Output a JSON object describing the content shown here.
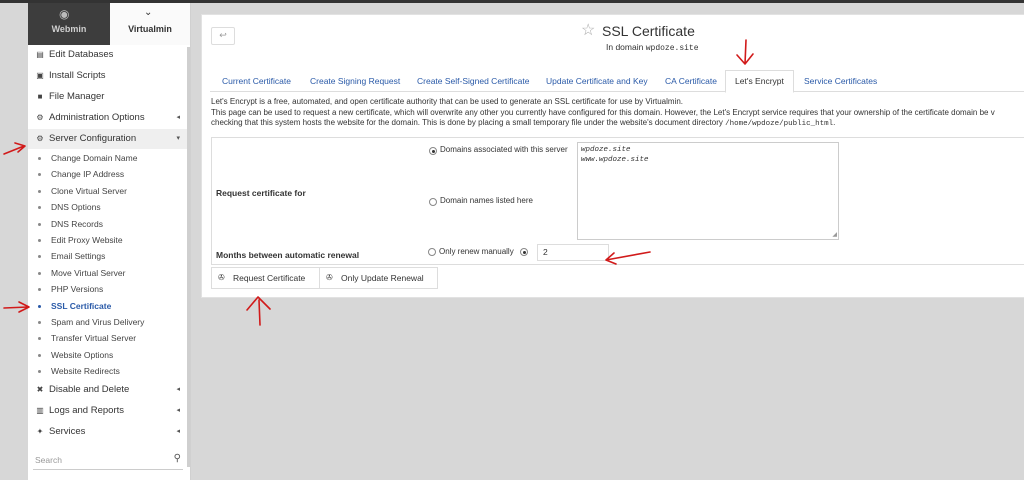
{
  "sidebar": {
    "tabs": [
      {
        "label": "Webmin",
        "icon": "webmin-logo-icon"
      },
      {
        "label": "Virtualmin",
        "icon": "chevron-down-icon"
      }
    ],
    "items": [
      {
        "label": "Edit Databases",
        "icon": "database-icon"
      },
      {
        "label": "Install Scripts",
        "icon": "terminal-icon"
      },
      {
        "label": "File Manager",
        "icon": "folder-icon"
      },
      {
        "label": "Administration Options",
        "icon": "gear-icon",
        "arrow": "◂"
      },
      {
        "label": "Server Configuration",
        "icon": "gears-icon",
        "arrow": "▾"
      }
    ],
    "sub_items": [
      "Change Domain Name",
      "Change IP Address",
      "Clone Virtual Server",
      "DNS Options",
      "DNS Records",
      "Edit Proxy Website",
      "Email Settings",
      "Move Virtual Server",
      "PHP Versions",
      "SSL Certificate",
      "Spam and Virus Delivery",
      "Transfer Virtual Server",
      "Website Options",
      "Website Redirects"
    ],
    "selected_sub_item": "SSL Certificate",
    "bottom_items": [
      {
        "label": "Disable and Delete",
        "icon": "trash-icon",
        "arrow": "◂"
      },
      {
        "label": "Logs and Reports",
        "icon": "chart-icon",
        "arrow": "◂"
      },
      {
        "label": "Services",
        "icon": "services-icon",
        "arrow": "◂"
      }
    ],
    "search_placeholder": "Search"
  },
  "header": {
    "title": "SSL Certificate",
    "subtitle_prefix": "In domain",
    "domain": "wpdoze.site"
  },
  "tabs": [
    "Current Certificate",
    "Create Signing Request",
    "Create Self-Signed Certificate",
    "Update Certificate and Key",
    "CA Certificate",
    "Let's Encrypt",
    "Service Certificates"
  ],
  "active_tab": "Let's Encrypt",
  "description": {
    "line1": "Let's Encrypt is a free, automated, and open certificate authority that can be used to generate an SSL certificate for use by Virtualmin.",
    "line2": "This page can be used to request a new certificate, which will overwrite any other you currently have configured for this domain. However, the Let's Encrypt service requires that your ownership of the certificate domain be v",
    "line3": "checking that this system hosts the website for the domain. This is done by placing a small temporary file under the website's document directory",
    "path": "/home/wpdoze/public_html",
    "line3_end": "."
  },
  "form": {
    "request_label": "Request certificate for",
    "option_associated": "Domains associated with this server",
    "option_listed": "Domain names listed here",
    "domains": [
      "wpdoze.site",
      "www.wpdoze.site"
    ],
    "renewal_label": "Months between automatic renewal",
    "renew_manual": "Only renew manually",
    "renew_months": "2"
  },
  "buttons": {
    "request": "Request Certificate",
    "update_renewal": "Only Update Renewal"
  },
  "colors": {
    "link": "#2a5aa8",
    "annotation": "#d11a1a"
  }
}
